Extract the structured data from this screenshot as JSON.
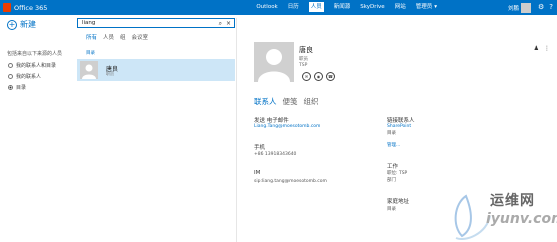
{
  "header": {
    "app_title": "Office 365",
    "nav": [
      "Outlook",
      "日历",
      "人员",
      "新闻源",
      "SkyDrive",
      "网站"
    ],
    "active_nav_index": 2,
    "admin_label": "管理员",
    "user_name": "刘鹏",
    "colors": {
      "bar": "#0072c6",
      "logo": "#eb3c00"
    }
  },
  "sidebar": {
    "new_label": "新建",
    "filter_title": "包括来自以下来源的人员",
    "filters": [
      {
        "label": "我的联系人和目录",
        "checked": false
      },
      {
        "label": "我的联系人",
        "checked": false
      },
      {
        "label": "目录",
        "checked": true
      }
    ]
  },
  "search": {
    "value": "liang"
  },
  "result_tabs": [
    "所有",
    "人员",
    "组",
    "会议室"
  ],
  "active_tab_index": 0,
  "directory_label": "目录",
  "results": [
    {
      "name": "唐良",
      "subtitle": "职员"
    }
  ],
  "contact": {
    "name": "唐良",
    "title": "职员",
    "company": "TSP",
    "tabs": [
      "联系人",
      "便笺",
      "组织"
    ],
    "active_tab_index": 0,
    "email_heading": "发送 电子邮件",
    "email": "Liang.Tang@moesotomb.com",
    "mobile_heading": "手机",
    "mobile": "+86 13918343640",
    "im_heading": "IM",
    "im": "sip:liang.tang@moesotomb.com",
    "linked_heading": "链接联系人",
    "linked_source": "SharePoint",
    "linked_dir": "目录",
    "manage_label": "管理...",
    "work_heading": "工作",
    "work_title": "职位: TSP",
    "work_dept": "部门",
    "home_heading": "家庭地址",
    "home_value": "目录"
  },
  "watermark": {
    "cn": "运维网",
    "url": "iyunv.com"
  }
}
